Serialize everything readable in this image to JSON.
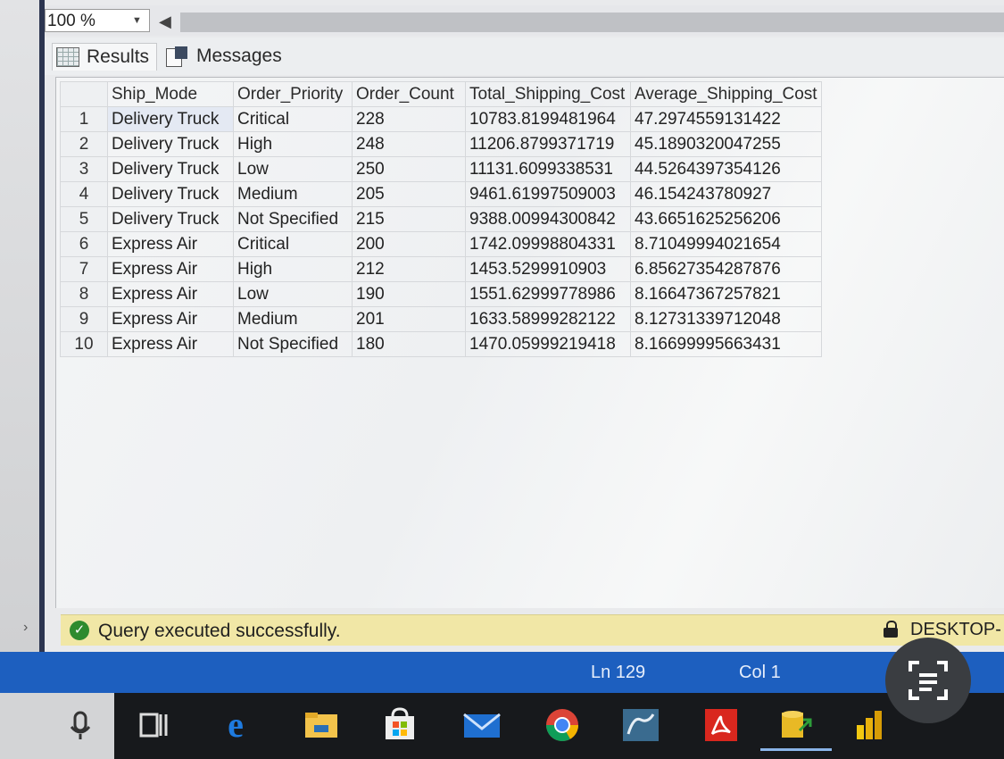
{
  "toolbar": {
    "zoom_value": "100 %"
  },
  "tabs": [
    {
      "label": "Results"
    },
    {
      "label": "Messages"
    }
  ],
  "grid": {
    "columns": [
      "Ship_Mode",
      "Order_Priority",
      "Order_Count",
      "Total_Shipping_Cost",
      "Average_Shipping_Cost"
    ],
    "rows": [
      {
        "n": "1",
        "ship_mode": "Delivery Truck",
        "priority": "Critical",
        "count": "228",
        "total": "10783.8199481964",
        "avg": "47.2974559131422"
      },
      {
        "n": "2",
        "ship_mode": "Delivery Truck",
        "priority": "High",
        "count": "248",
        "total": "11206.8799371719",
        "avg": "45.1890320047255"
      },
      {
        "n": "3",
        "ship_mode": "Delivery Truck",
        "priority": "Low",
        "count": "250",
        "total": "11131.6099338531",
        "avg": "44.5264397354126"
      },
      {
        "n": "4",
        "ship_mode": "Delivery Truck",
        "priority": "Medium",
        "count": "205",
        "total": "9461.61997509003",
        "avg": "46.154243780927"
      },
      {
        "n": "5",
        "ship_mode": "Delivery Truck",
        "priority": "Not Specified",
        "count": "215",
        "total": "9388.00994300842",
        "avg": "43.6651625256206"
      },
      {
        "n": "6",
        "ship_mode": "Express Air",
        "priority": "Critical",
        "count": "200",
        "total": "1742.09998804331",
        "avg": "8.71049994021654"
      },
      {
        "n": "7",
        "ship_mode": "Express Air",
        "priority": "High",
        "count": "212",
        "total": "1453.5299910903",
        "avg": "6.85627354287876"
      },
      {
        "n": "8",
        "ship_mode": "Express Air",
        "priority": "Low",
        "count": "190",
        "total": "1551.62999778986",
        "avg": "8.16647367257821"
      },
      {
        "n": "9",
        "ship_mode": "Express Air",
        "priority": "Medium",
        "count": "201",
        "total": "1633.58999282122",
        "avg": "8.12731339712048"
      },
      {
        "n": "10",
        "ship_mode": "Express Air",
        "priority": "Not Specified",
        "count": "180",
        "total": "1470.05999219418",
        "avg": "8.16699995663431"
      }
    ]
  },
  "status": {
    "message": "Query executed successfully.",
    "server": "DESKTOP-N"
  },
  "editor_status": {
    "line": "Ln 129",
    "col": "Col 1"
  },
  "colors": {
    "status_bar": "#f1e7a6",
    "editor_status_bar": "#1d5fbf",
    "success": "#2e8b2e"
  },
  "taskbar_icons": [
    "mic-icon",
    "task-view-icon",
    "edge-icon",
    "file-explorer-icon",
    "store-icon",
    "mail-icon",
    "chrome-icon",
    "mysql-icon",
    "acrobat-icon",
    "ssms-icon",
    "power-bi-icon"
  ]
}
